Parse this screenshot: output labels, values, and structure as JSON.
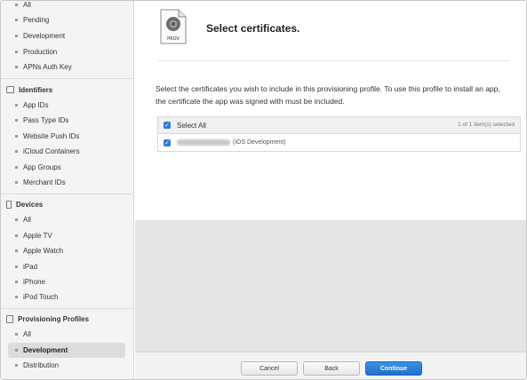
{
  "sidebar": {
    "certificates_items": [
      "All",
      "Pending",
      "Development",
      "Production",
      "APNs Auth Key"
    ],
    "identifiers": {
      "title": "Identifiers",
      "items": [
        "App IDs",
        "Pass Type IDs",
        "Website Push IDs",
        "iCloud Containers",
        "App Groups",
        "Merchant IDs"
      ]
    },
    "devices": {
      "title": "Devices",
      "items": [
        "All",
        "Apple TV",
        "Apple Watch",
        "iPad",
        "iPhone",
        "iPod Touch"
      ]
    },
    "profiles": {
      "title": "Provisioning Profiles",
      "items": [
        "All",
        "Development",
        "Distribution"
      ],
      "active": "Development"
    }
  },
  "main": {
    "icon_label": "PROV",
    "title": "Select certificates.",
    "description": "Select the certificates you wish to include in this provisioning profile. To use this profile to install an app, the certificate the app was signed with must be included.",
    "table": {
      "select_all_label": "Select All",
      "selection_count": "1  of 1 item(s) selected",
      "rows": [
        {
          "name": "Mingruang Zhao",
          "type": "(iOS Development)"
        }
      ]
    },
    "buttons": {
      "cancel": "Cancel",
      "back": "Back",
      "continue": "Continue"
    }
  }
}
